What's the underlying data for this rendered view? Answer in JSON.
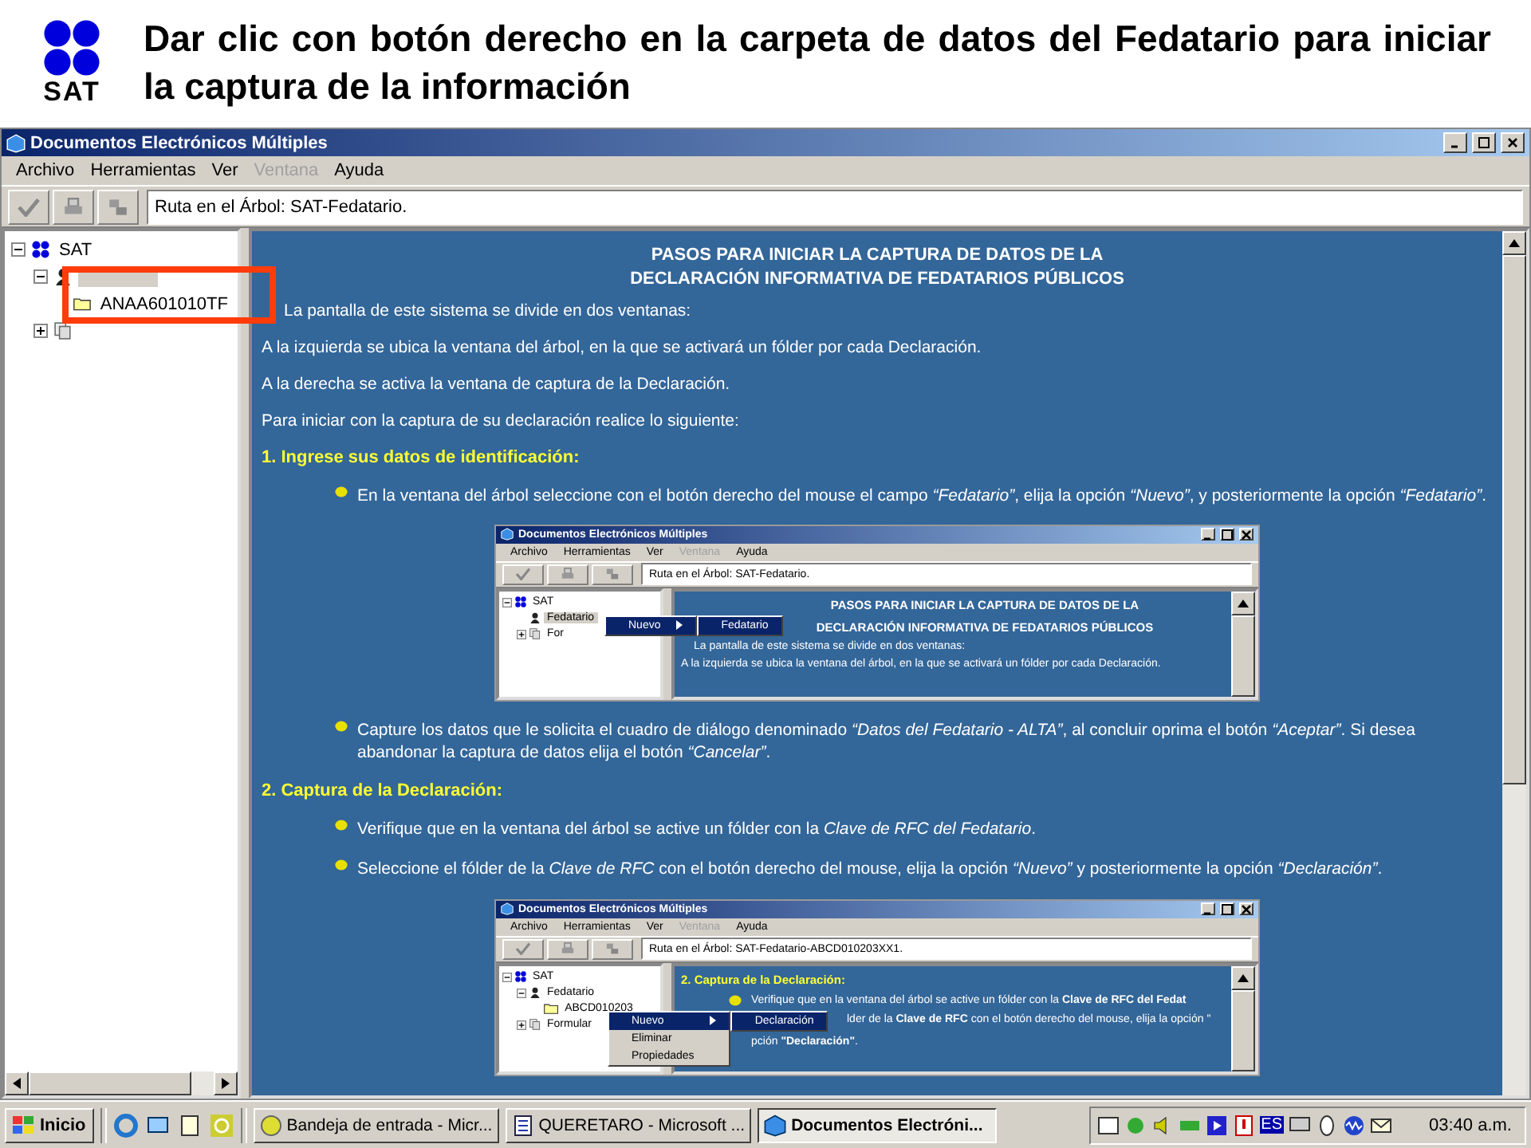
{
  "slide": {
    "title": "Dar clic con botón derecho en la carpeta de datos del Fedatario para iniciar la captura de la información",
    "logo_text": "SAT"
  },
  "window": {
    "title": "Documentos Electrónicos Múltiples"
  },
  "menu": [
    {
      "label": "Archivo",
      "disabled": false
    },
    {
      "label": "Herramientas",
      "disabled": false
    },
    {
      "label": "Ver",
      "disabled": false
    },
    {
      "label": "Ventana",
      "disabled": true
    },
    {
      "label": "Ayuda",
      "disabled": false
    }
  ],
  "toolbar": {
    "path": "Ruta en el Árbol: SAT-Fedatario."
  },
  "tree": [
    {
      "label": "SAT",
      "kind": "root",
      "expanded": true,
      "selected": false,
      "children": [
        {
          "kind": "person",
          "expanded": true,
          "selected": true,
          "children": [
            {
              "label": "ANAA601010TF",
              "kind": "folder",
              "selected": false
            }
          ]
        },
        {
          "kind": "forms",
          "expanded": false,
          "selected": false
        }
      ]
    }
  ],
  "content": {
    "heading": [
      "PASOS PARA INICIAR LA CAPTURA DE DATOS DE LA",
      "DECLARACIÓN INFORMATIVA DE FEDATARIOS PÚBLICOS"
    ],
    "blocks": [
      {
        "kind": "lead",
        "text": "La pantalla de este sistema se divide en dos ventanas:"
      },
      {
        "kind": "para",
        "text": "A la izquierda se ubica la ventana del árbol, en la que se activará un fólder por cada Declaración."
      },
      {
        "kind": "para",
        "text": "A la derecha se activa la ventana de captura de la Declaración."
      },
      {
        "kind": "para",
        "text": "Para iniciar con la captura de su declaración realice lo siguiente:"
      },
      {
        "kind": "section",
        "text": "1. Ingrese sus datos de identificación:"
      },
      {
        "kind": "bullet",
        "text": "En la ventana del árbol seleccione con el botón derecho del mouse el campo *“Fedatario”*, elija la opción *“Nuevo”*, y posteriormente la opción *“Fedatario”*."
      },
      {
        "kind": "screenshot",
        "title": "Documentos Electrónicos Múltiples",
        "menu": [
          {
            "label": "Archivo",
            "disabled": false
          },
          {
            "label": "Herramientas",
            "disabled": false
          },
          {
            "label": "Ver",
            "disabled": false
          },
          {
            "label": "Ventana",
            "disabled": true
          },
          {
            "label": "Ayuda",
            "disabled": false
          }
        ],
        "path": "Ruta en el Árbol: SAT-Fedatario.",
        "tree": [
          {
            "label": "SAT",
            "kind": "root",
            "expanded": true,
            "selected": false,
            "children": [
              {
                "label": "Fedatario",
                "kind": "person",
                "selected": true
              },
              {
                "label": "For",
                "kind": "forms",
                "expanded": false,
                "selected": false
              }
            ]
          }
        ],
        "context_menu": [
          {
            "label": "Nuevo",
            "submenu": true,
            "selected": true
          }
        ],
        "submenu": [
          {
            "label": "Fedatario",
            "selected": true
          }
        ],
        "lines": [
          {
            "kind": "heading",
            "text": "PASOS PARA INICIAR LA CAPTURA DE DATOS DE LA"
          },
          {
            "kind": "heading",
            "text": "DECLARACIÓN INFORMATIVA DE FEDATARIOS PÚBLICOS"
          },
          {
            "kind": "lead",
            "text": "La pantalla de este sistema se divide en dos ventanas:"
          },
          {
            "kind": "para",
            "text": "A la izquierda se ubica la ventana del árbol, en la que se activará un fólder por cada Declaración."
          }
        ]
      },
      {
        "kind": "bullet",
        "text": "Capture los datos que le solicita el cuadro de diálogo denominado *“Datos del Fedatario - ALTA”*, al concluir oprima el botón *“Aceptar”*. Si desea abandonar la captura de datos elija el botón *“Cancelar”*."
      },
      {
        "kind": "section",
        "text": "2. Captura de la Declaración:"
      },
      {
        "kind": "bullet",
        "text": "Verifique que en la ventana del árbol se active un fólder con la *Clave de RFC del Fedatario*."
      },
      {
        "kind": "bullet",
        "text": "Seleccione el fólder de la *Clave de RFC* con el botón derecho del mouse, elija la opción *“Nuevo”* y posteriormente la opción *“Declaración”*."
      },
      {
        "kind": "screenshot",
        "title": "Documentos Electrónicos Múltiples",
        "menu": [
          {
            "label": "Archivo",
            "disabled": false
          },
          {
            "label": "Herramientas",
            "disabled": false
          },
          {
            "label": "Ver",
            "disabled": false
          },
          {
            "label": "Ventana",
            "disabled": true
          },
          {
            "label": "Ayuda",
            "disabled": false
          }
        ],
        "path": "Ruta en el Árbol: SAT-Fedatario-ABCD010203XX1.",
        "tree": [
          {
            "label": "SAT",
            "kind": "root",
            "expanded": true,
            "selected": false,
            "children": [
              {
                "label": "Fedatario",
                "kind": "person",
                "expanded": true,
                "selected": false,
                "children": [
                  {
                    "label": "ABCD010203",
                    "kind": "folder",
                    "selected": false
                  }
                ]
              },
              {
                "label": "Formular",
                "kind": "forms",
                "expanded": false,
                "selected": false
              }
            ]
          }
        ],
        "context_menu": [
          {
            "label": "Nuevo",
            "submenu": true,
            "selected": true
          },
          {
            "label": "Eliminar",
            "submenu": false,
            "selected": false
          },
          {
            "label": "Propiedades",
            "submenu": false,
            "selected": false
          }
        ],
        "submenu": [
          {
            "label": "Declaración",
            "selected": true
          }
        ],
        "lines": [
          {
            "kind": "section",
            "text": "2. Captura de la Declaración:"
          },
          {
            "kind": "bullet",
            "text": "Verifique que en la ventana del árbol se active un fólder con la **Clave de RFC del Fedat**"
          },
          {
            "kind": "tail",
            "text": "lder de la **Clave de RFC** con el botón derecho del mouse, elija la opción \""
          },
          {
            "kind": "cont",
            "text": "pción **\"Declaración\"**."
          }
        ]
      }
    ]
  },
  "taskbar": {
    "start": "Inicio",
    "tasks": [
      {
        "label": "Bandeja de entrada - Micr...",
        "kind": "mail",
        "selected": false
      },
      {
        "label": "QUERETARO - Microsoft ...",
        "kind": "word",
        "selected": false
      },
      {
        "label": "Documentos Electróni...",
        "kind": "app",
        "selected": true
      }
    ],
    "language": "ES",
    "clock": "03:40 a.m."
  }
}
